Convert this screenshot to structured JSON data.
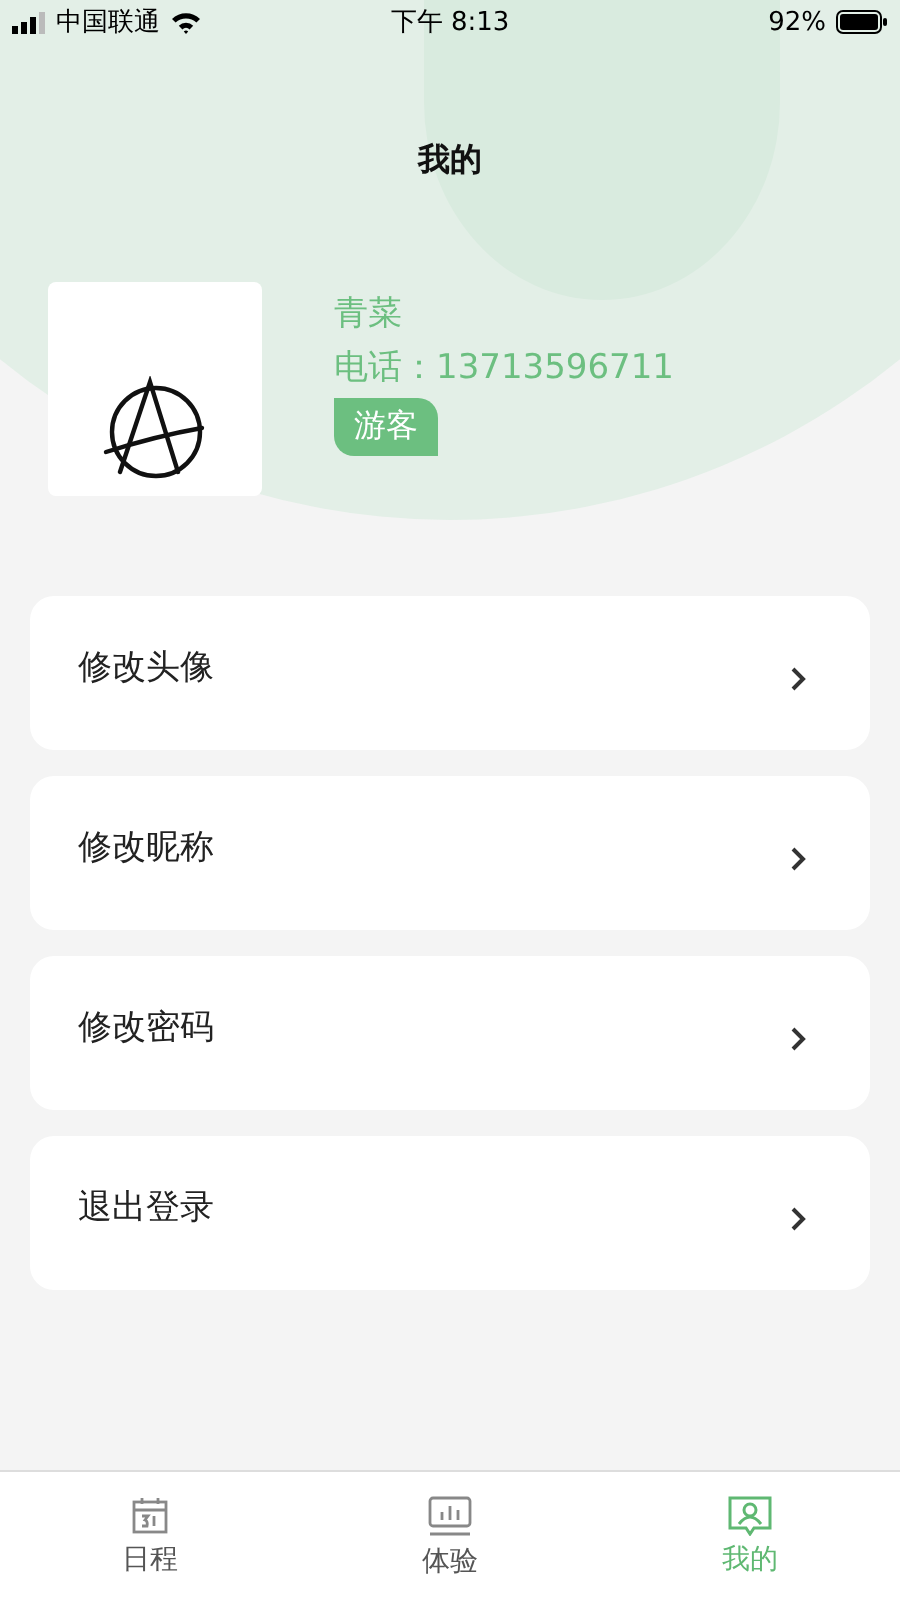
{
  "status_bar": {
    "carrier": "中国联通",
    "time": "下午 8:13",
    "battery": "92%"
  },
  "title": "我的",
  "profile": {
    "name": "青菜",
    "phone": "电话：13713596711",
    "role": "游客"
  },
  "menu": [
    {
      "label": "修改头像"
    },
    {
      "label": "修改昵称"
    },
    {
      "label": "修改密码"
    },
    {
      "label": "退出登录"
    }
  ],
  "tabs": [
    {
      "label": "日程",
      "selected": false
    },
    {
      "label": "体验",
      "selected": false
    },
    {
      "label": "我的",
      "selected": true
    }
  ]
}
